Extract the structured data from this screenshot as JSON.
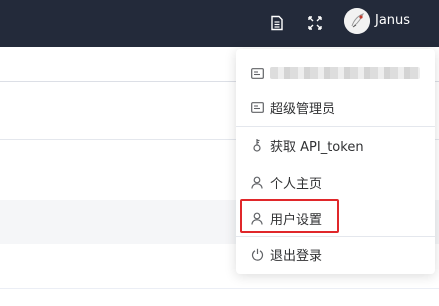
{
  "header": {
    "username": "Janus",
    "icons": [
      "document-icon",
      "fullscreen-icon"
    ]
  },
  "user_menu": {
    "items": [
      {
        "label": "",
        "icon": "id-card-icon",
        "note": "blurred"
      },
      {
        "label": "超级管理员",
        "icon": "id-card-icon"
      },
      {
        "label": "获取 API_token",
        "icon": "key-icon"
      },
      {
        "label": "个人主页",
        "icon": "user-icon"
      },
      {
        "label": "用户设置",
        "icon": "user-icon"
      },
      {
        "label": "退出登录",
        "icon": "power-icon"
      }
    ]
  },
  "colors": {
    "topbar": "#232a3a",
    "highlight": "#e0272a"
  }
}
